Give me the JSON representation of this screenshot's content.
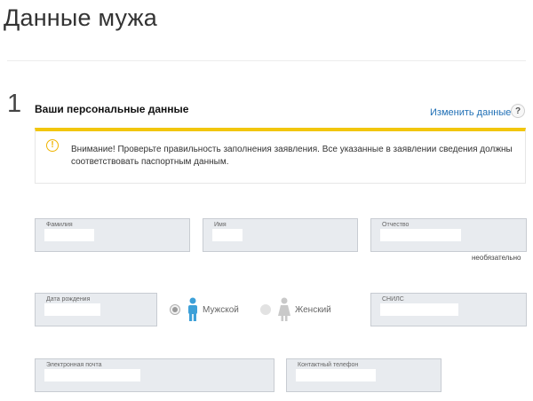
{
  "page": {
    "title": "Данные мужа"
  },
  "section": {
    "step_number": "1",
    "title": "Ваши персональные данные",
    "edit_link": "Изменить данные",
    "help": "?"
  },
  "warning": {
    "icon": "exclamation-icon",
    "text": "Внимание! Проверьте правильность заполнения заявления. Все указанные в заявлении сведения должны соответствовать паспортным данным.",
    "accent_color": "#f2c60d"
  },
  "form": {
    "surname_label": "Фамилия",
    "name_label": "Имя",
    "patronymic_label": "Отчество",
    "optional_note": "необязательно",
    "birth_date_label": "Дата рождения",
    "gender": {
      "male_label": "Мужской",
      "female_label": "Женский",
      "selected": "male",
      "male_icon_color": "#3da0d8",
      "female_icon_color": "#c9c9c9"
    },
    "snils_label": "СНИЛС",
    "email_label": "Электронная почта",
    "phone_label": "Контактный телефон"
  }
}
